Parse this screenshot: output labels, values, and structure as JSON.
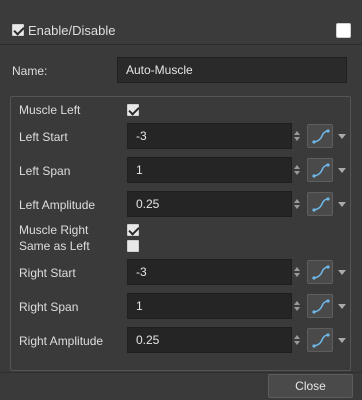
{
  "header": {
    "enable_label": "Enable/Disable",
    "enable_checked": true,
    "color_swatch": "#ffffff"
  },
  "name": {
    "label": "Name:",
    "value": "Auto-Muscle"
  },
  "muscle_left": {
    "label": "Muscle Left",
    "checked": true
  },
  "rows_left": [
    {
      "label": "Left Start",
      "value": "-3"
    },
    {
      "label": "Left Span",
      "value": "1"
    },
    {
      "label": "Left Amplitude",
      "value": "0.25"
    }
  ],
  "muscle_right": {
    "label": "Muscle Right",
    "checked": true
  },
  "same_as_left": {
    "label": "Same as Left",
    "checked": false
  },
  "rows_right": [
    {
      "label": "Right Start",
      "value": "-3"
    },
    {
      "label": "Right Span",
      "value": "1"
    },
    {
      "label": "Right Amplitude",
      "value": "0.25"
    }
  ],
  "footer": {
    "close_label": "Close"
  },
  "colors": {
    "function_accent": "#6fb8e8",
    "background": "#3a3a3a",
    "field": "#252525"
  }
}
